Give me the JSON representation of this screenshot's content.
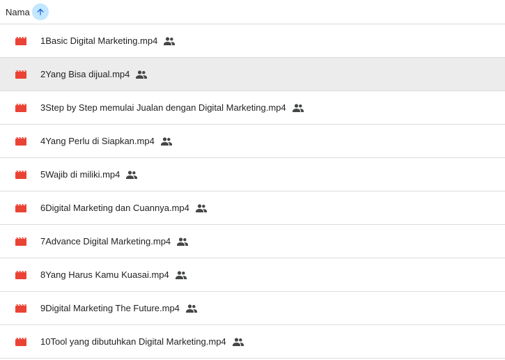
{
  "header": {
    "name_label": "Nama",
    "sort_direction": "ascending"
  },
  "colors": {
    "video_icon": "#ea4335",
    "sort_button_bg": "#c2e7ff",
    "selected_row_bg": "#ececec"
  },
  "icons": {
    "file_type": "video-file-icon",
    "shared": "shared-people-icon",
    "sort": "arrow-up-icon"
  },
  "files": [
    {
      "name": "1Basic Digital Marketing.mp4",
      "shared": true,
      "selected": false
    },
    {
      "name": "2Yang Bisa dijual.mp4",
      "shared": true,
      "selected": true
    },
    {
      "name": "3Step by Step memulai Jualan dengan Digital Marketing.mp4",
      "shared": true,
      "selected": false
    },
    {
      "name": "4Yang Perlu di Siapkan.mp4",
      "shared": true,
      "selected": false
    },
    {
      "name": "5Wajib di miliki.mp4",
      "shared": true,
      "selected": false
    },
    {
      "name": "6Digital Marketing dan Cuannya.mp4",
      "shared": true,
      "selected": false
    },
    {
      "name": "7Advance Digital Marketing.mp4",
      "shared": true,
      "selected": false
    },
    {
      "name": "8Yang Harus Kamu Kuasai.mp4",
      "shared": true,
      "selected": false
    },
    {
      "name": "9Digital Marketing The Future.mp4",
      "shared": true,
      "selected": false
    },
    {
      "name": "10Tool yang dibutuhkan Digital Marketing.mp4",
      "shared": true,
      "selected": false
    }
  ]
}
